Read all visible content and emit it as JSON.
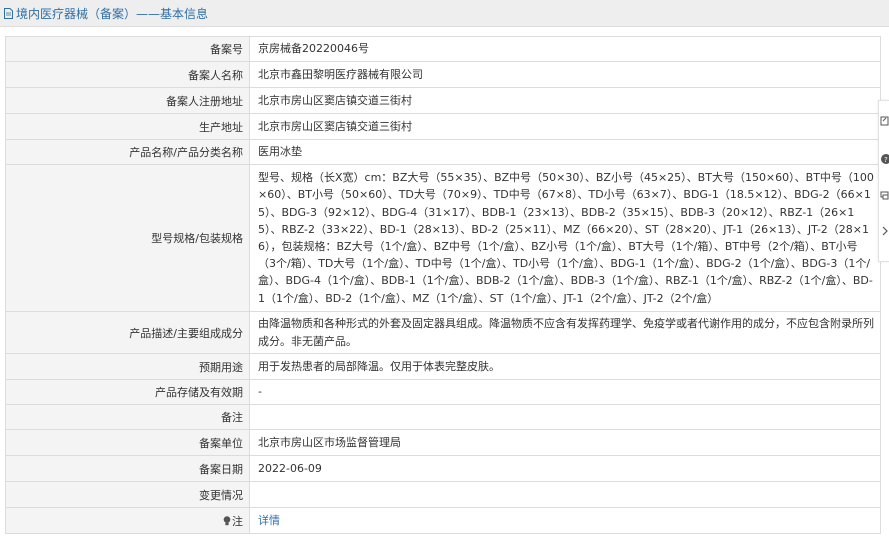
{
  "header": {
    "icon": "document-icon",
    "title": "境内医疗器械（备案）——基本信息"
  },
  "rows": [
    {
      "label": "备案号",
      "value": "京房械备20220046号"
    },
    {
      "label": "备案人名称",
      "value": "北京市鑫田黎明医疗器械有限公司"
    },
    {
      "label": "备案人注册地址",
      "value": "北京市房山区窦店镇交道三街村"
    },
    {
      "label": "生产地址",
      "value": "北京市房山区窦店镇交道三街村"
    },
    {
      "label": "产品名称/产品分类名称",
      "value": "医用冰垫"
    },
    {
      "label": "型号规格/包装规格",
      "value": "型号、规格（长X宽）cm：BZ大号（55×35）、BZ中号（50×30）、BZ小号（45×25）、BT大号（150×60）、BT中号（100×60）、BT小号（50×60）、TD大号（70×9）、TD中号（67×8）、TD小号（63×7）、BDG-1（18.5×12）、BDG-2（66×15）、BDG-3（92×12）、BDG-4（31×17）、BDB-1（23×13）、BDB-2（35×15）、BDB-3（20×12）、RBZ-1（26×15）、RBZ-2（33×22）、BD-1（28×13）、BD-2（25×11）、MZ（66×20）、ST（28×20）、JT-1（26×13）、JT-2（28×16），包装规格：BZ大号（1个/盒）、BZ中号（1个/盒）、BZ小号（1个/盒）、BT大号（1个/箱）、BT中号（2个/箱）、BT小号（3个/箱）、TD大号（1个/盒）、TD中号（1个/盒）、TD小号（1个/盒）、BDG-1（1个/盒）、BDG-2（1个/盒）、BDG-3（1个/盒）、BDG-4（1个/盒）、BDB-1（1个/盒）、BDB-2（1个/盒）、BDB-3（1个/盒）、RBZ-1（1个/盒）、RBZ-2（1个/盒）、BD-1（1个/盒）、BD-2（1个/盒）、MZ（1个/盒）、ST（1个/盒）、JT-1（2个/盒）、JT-2（2个/盒）"
    },
    {
      "label": "产品描述/主要组成成分",
      "value": "由降温物质和各种形式的外套及固定器具组成。降温物质不应含有发挥药理学、免疫学或者代谢作用的成分，不应包含附录所列成分。非无菌产品。"
    },
    {
      "label": "预期用途",
      "value": "用于发热患者的局部降温。仅用于体表完整皮肤。"
    },
    {
      "label": "产品存储及有效期",
      "value": "-"
    },
    {
      "label": "备注",
      "value": ""
    },
    {
      "label": "备案单位",
      "value": "北京市房山区市场监督管理局"
    },
    {
      "label": "备案日期",
      "value": "2022-06-09"
    },
    {
      "label": "变更情况",
      "value": ""
    }
  ],
  "note": {
    "icon": "lightbulb-icon",
    "label": "注",
    "link_text": "详情"
  },
  "side_tools": [
    "edit-icon",
    "help-icon",
    "print-icon",
    "chevron-right-icon"
  ],
  "colors": {
    "header_bg": "#eeeeee",
    "header_text": "#2f6fa8",
    "label_bg": "#f4f4f4",
    "border": "#dcdcdc",
    "link": "#2f6fa8"
  }
}
